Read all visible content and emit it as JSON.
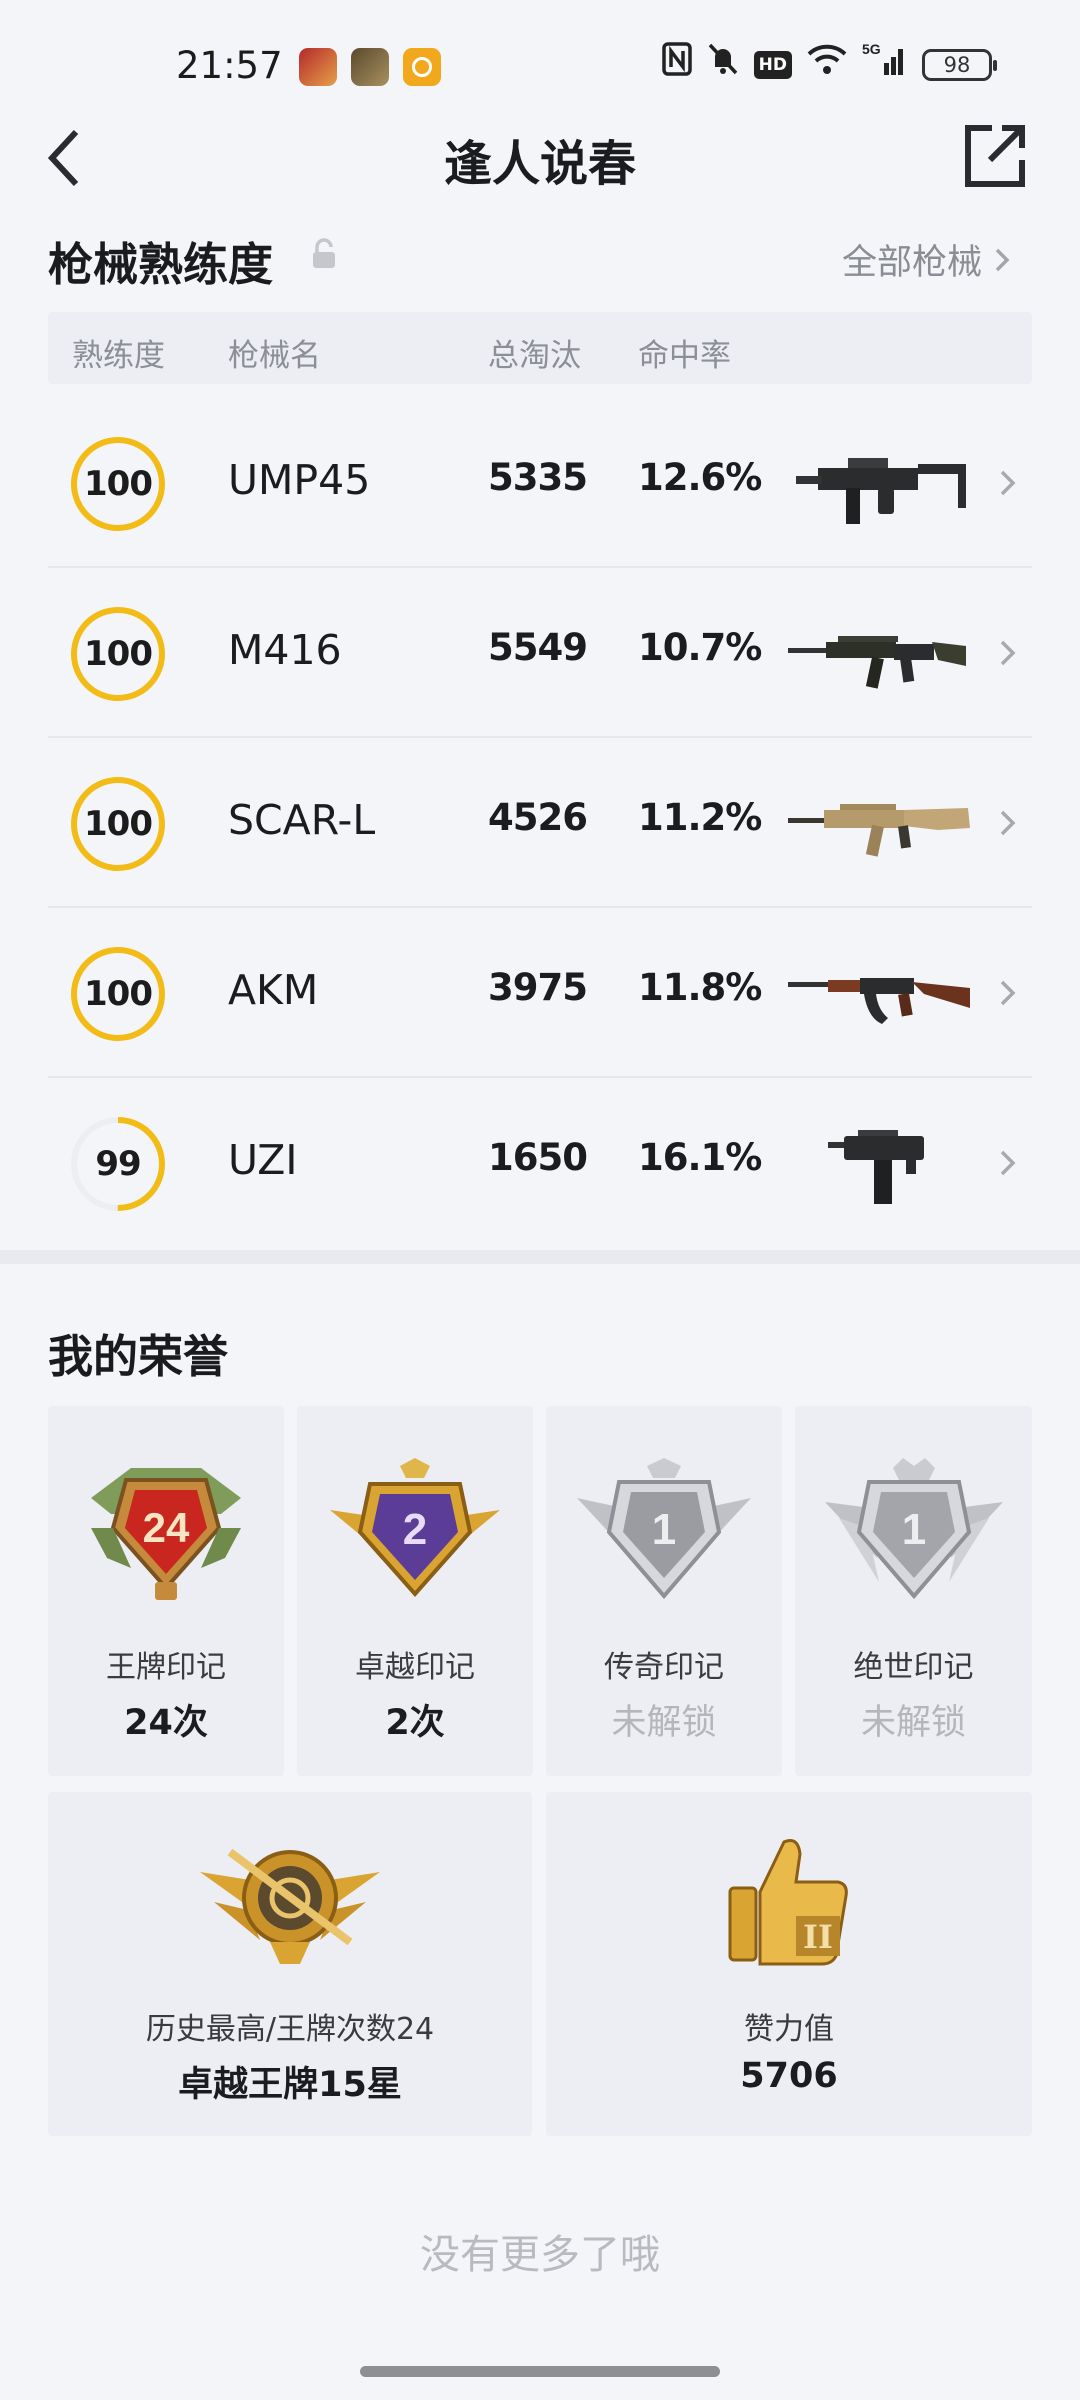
{
  "status_bar": {
    "time": "21:57",
    "network": "5G",
    "hd": "HD",
    "battery": "98"
  },
  "header": {
    "title": "逢人说春"
  },
  "weapons_section": {
    "title": "枪械熟练度",
    "all_link": "全部枪械",
    "columns": [
      "熟练度",
      "枪械名",
      "总淘汰",
      "命中率"
    ],
    "rows": [
      {
        "mastery": "100",
        "mastery_pct": 100,
        "name": "UMP45",
        "kills": "5335",
        "accuracy": "12.6%",
        "gun": "smg"
      },
      {
        "mastery": "100",
        "mastery_pct": 100,
        "name": "M416",
        "kills": "5549",
        "accuracy": "10.7%",
        "gun": "rifle-dark"
      },
      {
        "mastery": "100",
        "mastery_pct": 100,
        "name": "SCAR-L",
        "kills": "4526",
        "accuracy": "11.2%",
        "gun": "rifle-tan"
      },
      {
        "mastery": "100",
        "mastery_pct": 100,
        "name": "AKM",
        "kills": "3975",
        "accuracy": "11.8%",
        "gun": "ak"
      },
      {
        "mastery": "99",
        "mastery_pct": 50,
        "name": "UZI",
        "kills": "1650",
        "accuracy": "16.1%",
        "gun": "uzi"
      }
    ]
  },
  "honors_section": {
    "title": "我的荣誉",
    "badges": [
      {
        "label": "王牌印记",
        "value": "24次",
        "badge_number": "24",
        "locked": false,
        "icon": "ace-badge-icon"
      },
      {
        "label": "卓越印记",
        "value": "2次",
        "badge_number": "2",
        "locked": false,
        "icon": "excellence-badge-icon"
      },
      {
        "label": "传奇印记",
        "value": "未解锁",
        "badge_number": "1",
        "locked": true,
        "icon": "legend-badge-icon"
      },
      {
        "label": "绝世印记",
        "value": "未解锁",
        "badge_number": "1",
        "locked": true,
        "icon": "peerless-badge-icon"
      }
    ],
    "history": {
      "label": "历史最高/王牌次数24",
      "value": "卓越王牌15星"
    },
    "likes": {
      "label": "赞力值",
      "value": "5706"
    }
  },
  "footer": {
    "no_more": "没有更多了哦"
  },
  "colors": {
    "ring": "#f2bb16",
    "ring_track": "#eceef2",
    "background": "#f4f5f9",
    "gold": "#d9a431",
    "silver": "#a9abb0"
  }
}
